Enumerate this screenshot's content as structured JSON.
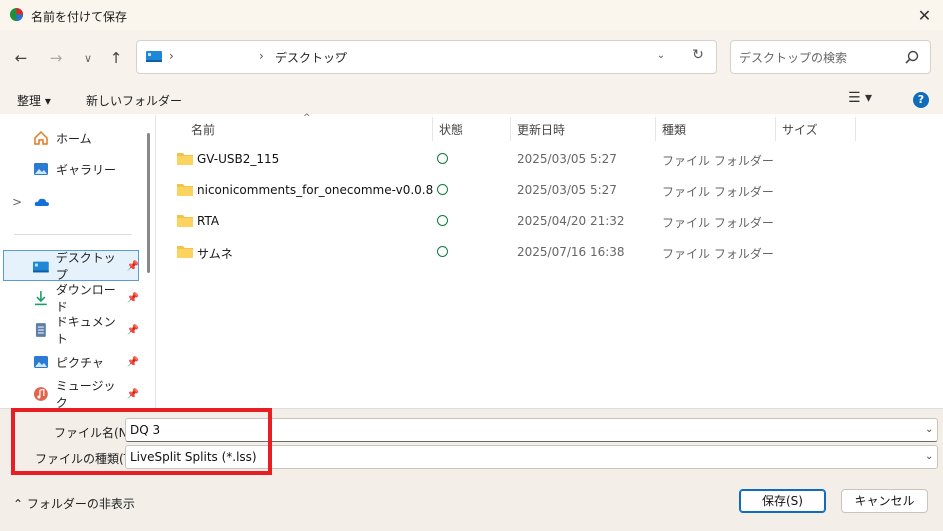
{
  "window": {
    "title": "名前を付けて保存",
    "close_glyph": "✕"
  },
  "nav": {
    "back_glyph": "←",
    "forward_glyph": "→",
    "recent_glyph": "∨",
    "up_glyph": "↑",
    "address": {
      "separators": [
        "›",
        "›",
        "›"
      ],
      "crumb": "デスクトップ",
      "dropdown_glyph": "⌄",
      "refresh_glyph": "↻"
    },
    "search": {
      "placeholder": "デスクトップの検索"
    }
  },
  "toolbar": {
    "organize_label": "整理 ▾",
    "new_folder_label": "新しいフォルダー",
    "view_glyph": "☰ ▾",
    "help_glyph": "?"
  },
  "sidebar": {
    "items": [
      {
        "label": "ホーム",
        "icon": "home-icon"
      },
      {
        "label": "ギャラリー",
        "icon": "gallery-icon"
      },
      {
        "label": "",
        "icon": "onedrive-icon",
        "expander": ">"
      },
      {
        "label": "デスクトップ",
        "icon": "desktop-icon",
        "pinned": true,
        "selected": true
      },
      {
        "label": "ダウンロード",
        "icon": "download-icon",
        "pinned": true
      },
      {
        "label": "ドキュメント",
        "icon": "document-icon",
        "pinned": true
      },
      {
        "label": "ピクチャ",
        "icon": "pictures-icon",
        "pinned": true
      },
      {
        "label": "ミュージック",
        "icon": "music-icon",
        "pinned": true
      }
    ],
    "pin_glyph": "📌"
  },
  "filelist": {
    "columns": [
      "名前",
      "状態",
      "更新日時",
      "種類",
      "サイズ"
    ],
    "sort_glyph": "^",
    "rows": [
      {
        "name": "GV-USB2_115",
        "modified": "2025/03/05 5:27",
        "type": "ファイル フォルダー"
      },
      {
        "name": "niconicomments_for_onecomme-v0.0.8",
        "modified": "2025/03/05 5:27",
        "type": "ファイル フォルダー"
      },
      {
        "name": "RTA",
        "modified": "2025/04/20 21:32",
        "type": "ファイル フォルダー"
      },
      {
        "name": "サムネ",
        "modified": "2025/07/16 16:38",
        "type": "ファイル フォルダー"
      }
    ]
  },
  "bottom": {
    "filename_label": "ファイル名(N):",
    "filename_value": "DQ 3",
    "filetype_label": "ファイルの種類(T):",
    "filetype_value": "LiveSplit Splits (*.lss)",
    "chevron_glyph": "⌄",
    "hide_folders_label": "⌃  フォルダーの非表示",
    "save_label": "保存(S)",
    "cancel_label": "キャンセル"
  },
  "colors": {
    "accent": "#0f6cbd",
    "highlight": "#e81e25",
    "folder": "#f3c24a",
    "status_ok": "#0f7b3d"
  }
}
